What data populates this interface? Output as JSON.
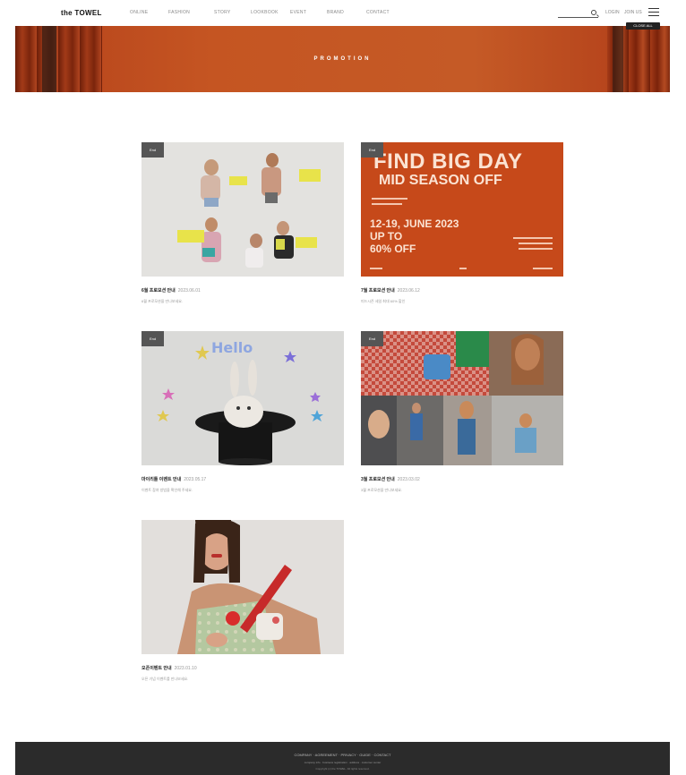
{
  "header": {
    "logo": "the TOWEL",
    "nav": [
      "ONLINE",
      "FASHION",
      "STORY",
      "LOOKBOOK",
      "EVENT",
      "BRAND",
      "CONTACT"
    ],
    "login": "LOGIN",
    "join": "JOIN US",
    "tooltip": "CLOSE ALL"
  },
  "banner": {
    "title": "PROMOTION"
  },
  "cards": [
    {
      "badge": "End",
      "title": "6월 프로모션 안내",
      "date": "2023.06.01",
      "desc": "6월 프로모션을 만나보세요.",
      "image": "lookbook-collage"
    },
    {
      "badge": "End",
      "title": "7월 프로모션 안내",
      "date": "2023.06.12",
      "desc": "미드시즌 세일 최대 60% 할인",
      "image": "big-day-poster",
      "poster": {
        "line1": "FIND BIG DAY",
        "line2": "MID SEASON OFF",
        "dates": "12-19, JUNE 2023",
        "upto": "UP TO",
        "off": "60% OFF"
      }
    },
    {
      "badge": "End",
      "title": "마이리틀 이벤트 안내",
      "date": "2023.05.17",
      "desc": "이벤트 참여 방법을 확인해 주세요.",
      "image": "bunny-hat",
      "text": "Hello"
    },
    {
      "badge": "End",
      "title": "3월 프로모션 안내",
      "date": "2023.03.02",
      "desc": "3월 프로모션을 만나보세요.",
      "image": "spring-collage"
    },
    {
      "badge": "",
      "title": "오픈이벤트 안내",
      "date": "2023.01.10",
      "desc": "오픈 기념 이벤트를 만나보세요.",
      "image": "red-bag-girl"
    }
  ],
  "footer": {
    "links": "COMPANY · AGREEMENT · PRIVACY · GUIDE · CONTACT",
    "info": "company info · business registration · address · customer center",
    "copy": "Copyright (c) the TOWEL. All rights reserved."
  }
}
